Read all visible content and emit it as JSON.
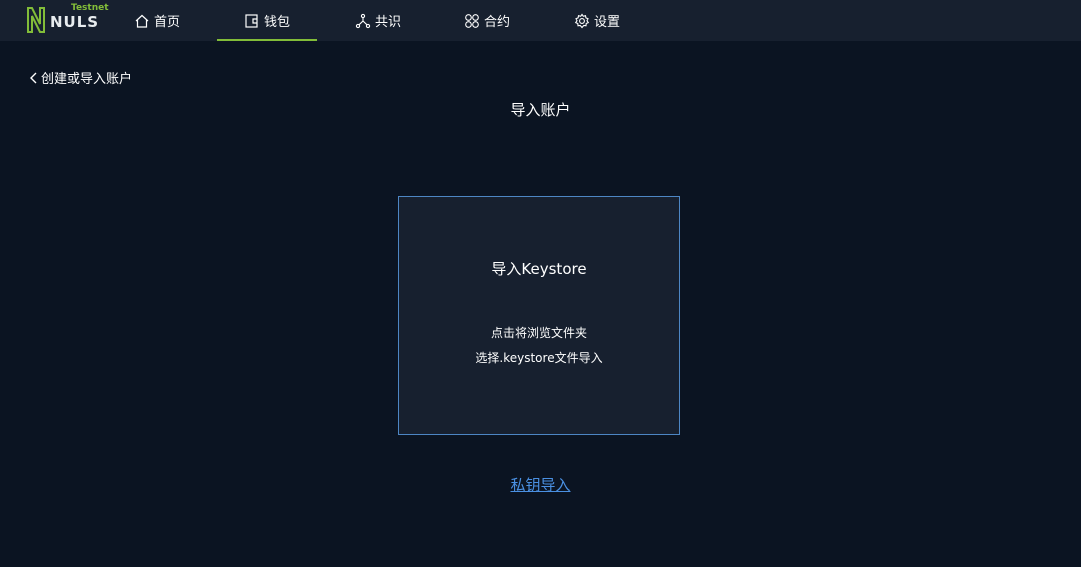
{
  "brand": {
    "name": "NULS",
    "badge": "Testnet",
    "accent_color": "#82bd39"
  },
  "nav": {
    "items": [
      {
        "label": "首页",
        "icon": "home-icon",
        "active": false
      },
      {
        "label": "钱包",
        "icon": "wallet-icon",
        "active": true
      },
      {
        "label": "共识",
        "icon": "consensus-icon",
        "active": false
      },
      {
        "label": "合约",
        "icon": "contract-icon",
        "active": false
      },
      {
        "label": "设置",
        "icon": "gear-icon",
        "active": false
      }
    ]
  },
  "back": {
    "label": "创建或导入账户",
    "icon": "chevron-left-icon"
  },
  "page": {
    "title": "导入账户"
  },
  "keystore_card": {
    "title": "导入Keystore",
    "line1": "点击将浏览文件夹",
    "line2": "选择.keystore文件导入",
    "border_color": "#4d86c4"
  },
  "private_key_link": {
    "label": "私钥导入",
    "color": "#4a90e2"
  }
}
